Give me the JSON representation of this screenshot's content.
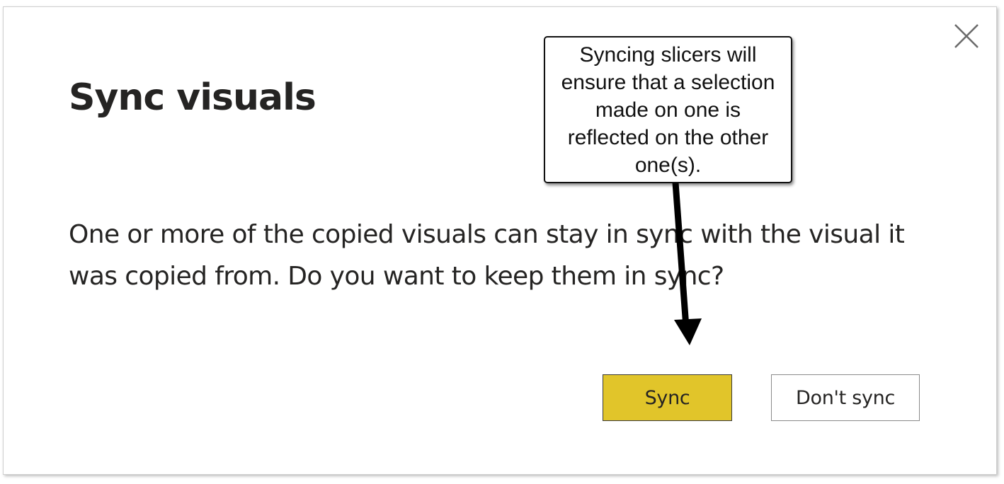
{
  "dialog": {
    "title": "Sync visuals",
    "message": "One or more of the copied visuals can stay in sync with the visual it was copied from. Do you want to keep them in sync?",
    "close_icon": "close-icon",
    "buttons": {
      "sync_label": "Sync",
      "dont_sync_label": "Don't sync"
    }
  },
  "annotation": {
    "callout_text": "Syncing slicers will ensure that a selection made on one is reflected on the other one(s)."
  },
  "colors": {
    "primary_button": "#e1c52a",
    "text": "#252423",
    "arrow": "#000000"
  }
}
